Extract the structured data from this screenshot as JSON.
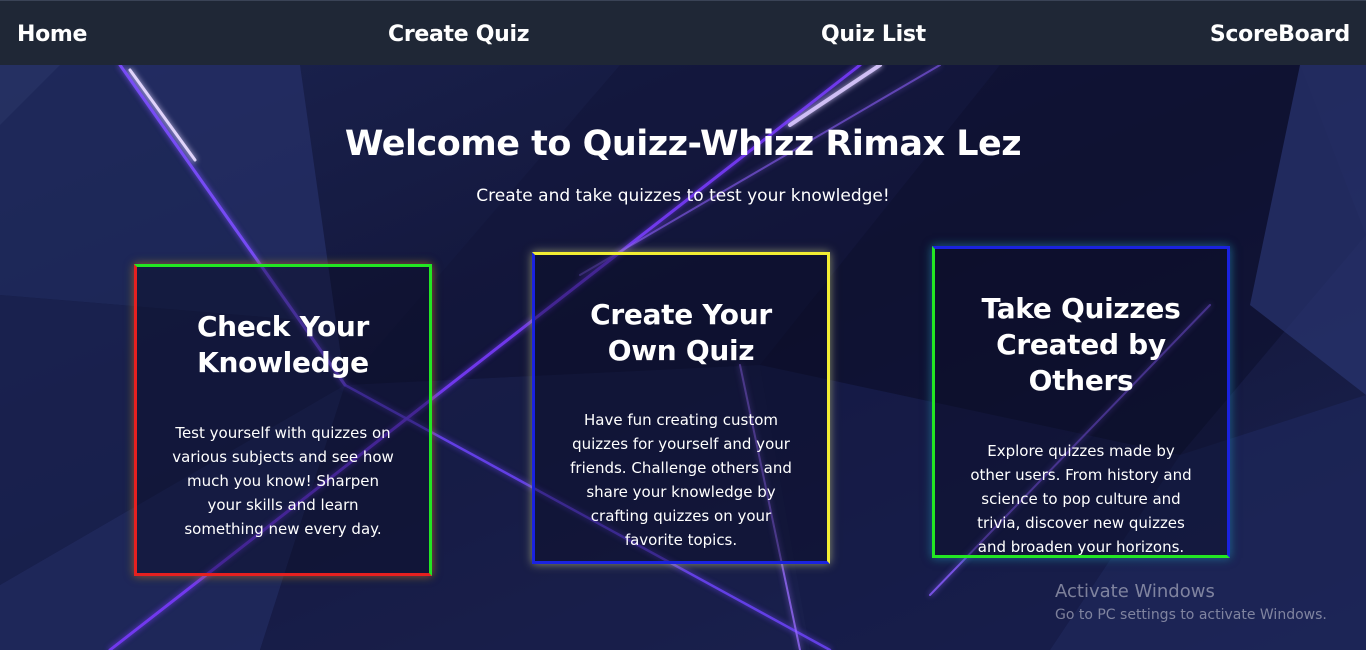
{
  "nav": {
    "home": "Home",
    "create_quiz": "Create Quiz",
    "quiz_list": "Quiz List",
    "scoreboard": "ScoreBoard"
  },
  "hero": {
    "title": "Welcome to Quizz-Whizz Rimax Lez",
    "subtitle": "Create and take quizzes to test your knowledge!"
  },
  "cards": [
    {
      "title": "Check Your Knowledge",
      "description": "Test yourself with quizzes on various subjects and see how much you know! Sharpen your skills and learn something new every day."
    },
    {
      "title": "Create Your Own Quiz",
      "description": "Have fun creating custom quizzes for yourself and your friends. Challenge others and share your knowledge by crafting quizzes on your favorite topics."
    },
    {
      "title": "Take Quizzes Created by Others",
      "description": "Explore quizzes made by other users. From history and science to pop culture and trivia, discover new quizzes and broaden your horizons."
    }
  ],
  "watermark": {
    "title": "Activate Windows",
    "subtitle": "Go to PC settings to activate Windows."
  },
  "colors": {
    "navbar": "#1f2736",
    "background": "#0d0f26",
    "glow": "#8b5cf6",
    "red": "#e62020",
    "green": "#23e623",
    "yellow": "#f3ee33",
    "blue": "#1a22e0"
  }
}
